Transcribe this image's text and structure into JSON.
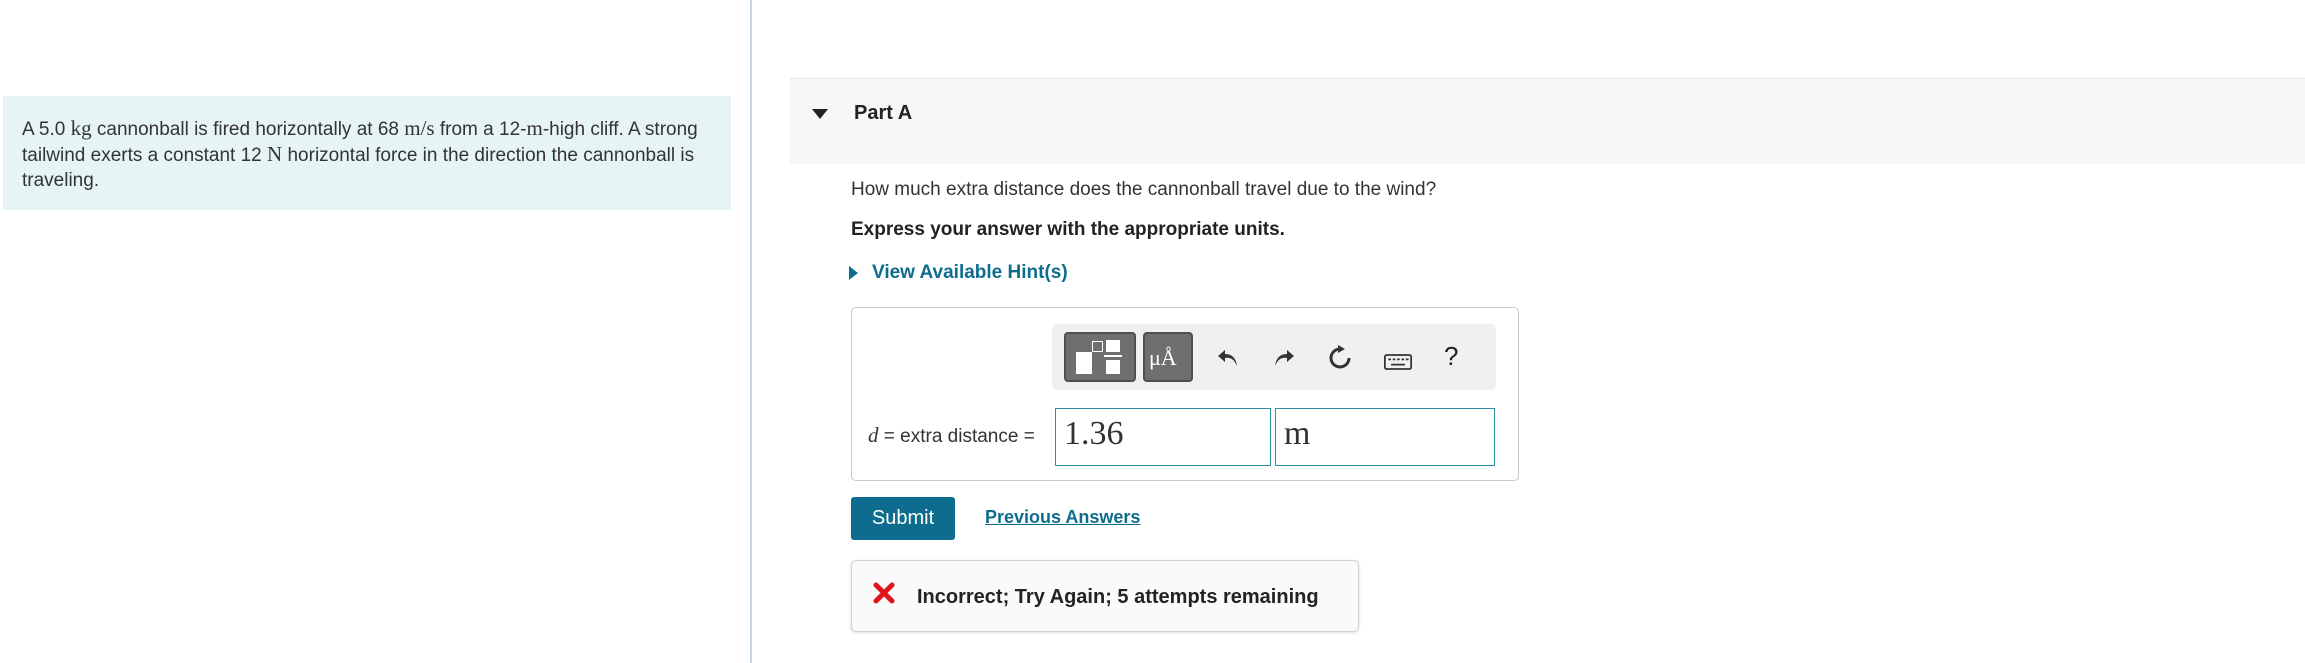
{
  "problem": {
    "seg1": "A 5.0 ",
    "mass_unit": "kg",
    "seg2": " cannonball is fired horizontally at 68 ",
    "speed_unit": "m/s",
    "seg3": " from a 12-",
    "height_unit": "m",
    "seg4": "-high cliff. A strong tailwind exerts a constant 12 ",
    "force_unit": "N",
    "seg5": " horizontal force in the direction the cannonball is traveling."
  },
  "part": {
    "title": "Part A"
  },
  "question": {
    "text": "How much extra distance does the cannonball travel due to the wind?",
    "instructions": "Express your answer with the appropriate units.",
    "hints_label": "View Available Hint(s)"
  },
  "toolbar": {
    "template_icon": "fraction-template-icon",
    "units_icon": "units-icon",
    "units_label": "μÅ",
    "undo_icon": "undo-icon",
    "redo_icon": "redo-icon",
    "reset_icon": "reset-icon",
    "keyboard_icon": "keyboard-icon",
    "help_label": "?"
  },
  "answer": {
    "variable": "d",
    "label": " = extra distance = ",
    "value": "1.36",
    "unit": "m"
  },
  "actions": {
    "submit_label": "Submit",
    "previous_answers_label": "Previous Answers"
  },
  "feedback": {
    "message": "Incorrect; Try Again; 5 attempts remaining",
    "status_color": "#e0151b"
  },
  "colors": {
    "accent": "#0e6d8e",
    "problem_bg": "#e6f4f5",
    "divider": "#c7d6e6"
  }
}
